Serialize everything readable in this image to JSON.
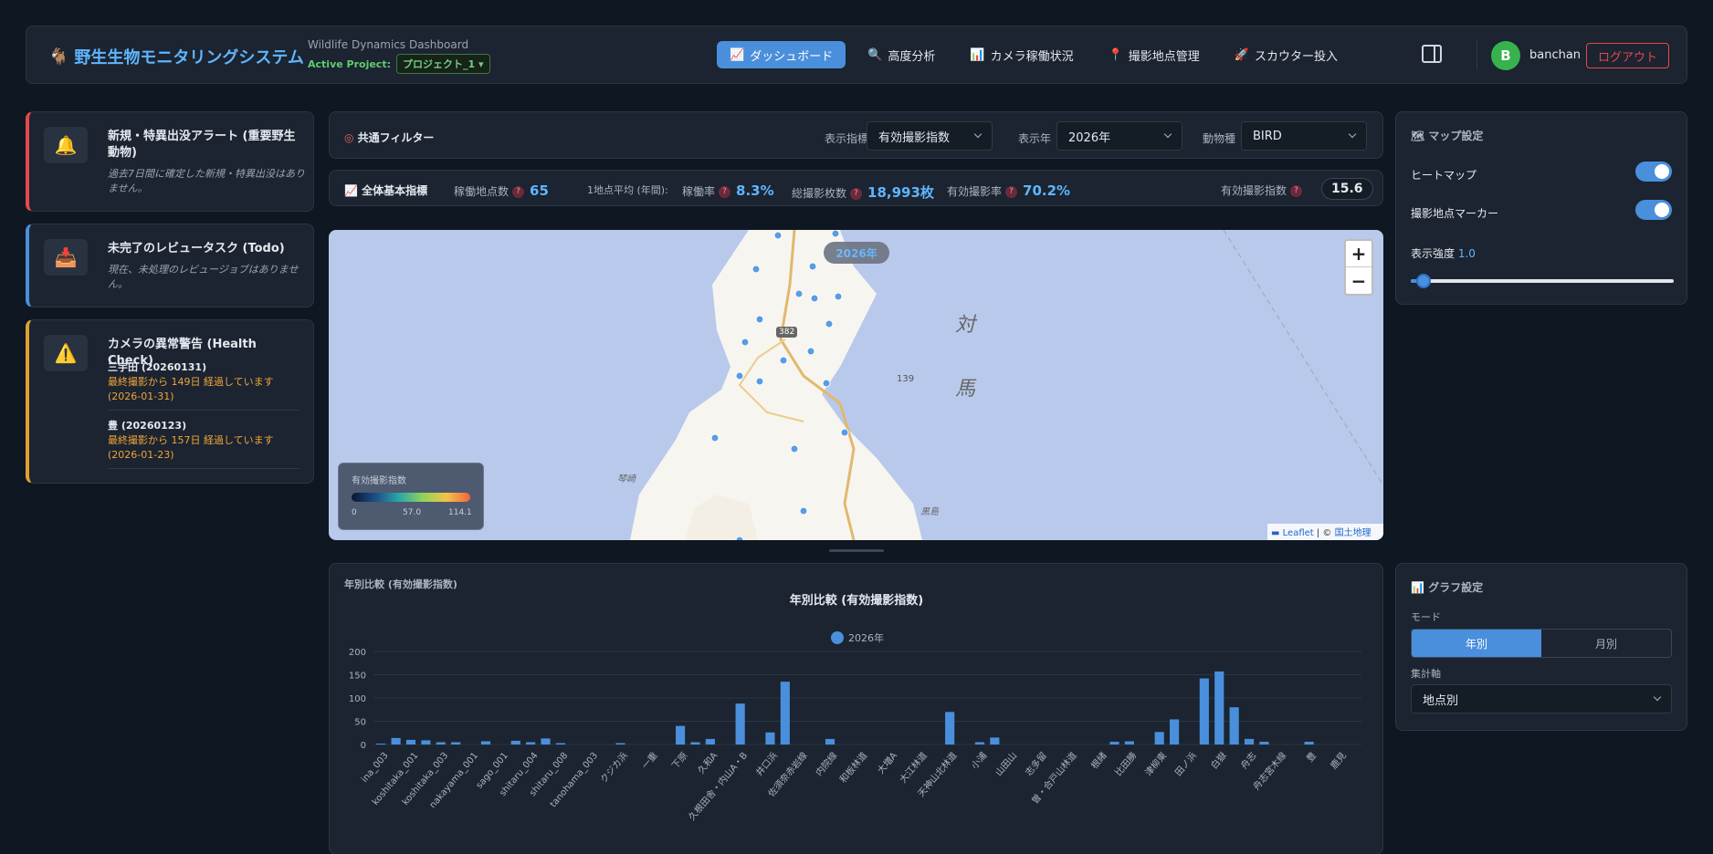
{
  "header": {
    "brand": "野生生物モニタリングシステム",
    "subtitle": "Wildlife Dynamics Dashboard",
    "project_label": "Active Project:",
    "project_value": "プロジェクト_1",
    "nav": [
      {
        "label": "ダッシュボード",
        "icon": "chart-icon",
        "active": true
      },
      {
        "label": "高度分析",
        "icon": "magnifier-icon",
        "active": false
      },
      {
        "label": "カメラ稼働状況",
        "icon": "bar-chart-icon",
        "active": false
      },
      {
        "label": "撮影地点管理",
        "icon": "pin-icon",
        "active": false
      },
      {
        "label": "スカウター投入",
        "icon": "rocket-icon",
        "active": false
      }
    ],
    "avatar_initial": "B",
    "user": "banchan",
    "logout": "ログアウト"
  },
  "alerts": {
    "new_title": "新規・特異出没アラート (重要野生動物)",
    "new_desc": "過去7日間に確定した新規・特異出没はありません。",
    "todo_title": "未完了のレビュータスク (Todo)",
    "todo_desc": "現在、未処理のレビュージョブはありません。",
    "health_title": "カメラの異常警告 (Health Check)",
    "health_items": [
      {
        "name": "三宇田 (20260131)",
        "warn": "最終撮影から 149日 経過しています (2026-01-31)"
      },
      {
        "name": "豊 (20260123)",
        "warn": "最終撮影から 157日 経過しています (2026-01-23)"
      }
    ]
  },
  "filter": {
    "title": "共通フィルター",
    "metric_label": "表示指標",
    "metric_value": "有効撮影指数",
    "year_label": "表示年",
    "year_value": "2026年",
    "species_label": "動物種",
    "species_value": "BIRD"
  },
  "metrics": {
    "title": "全体基本指標",
    "sites_label": "稼働地点数",
    "sites_value": "65",
    "avg_label": "1地点平均 (年間):",
    "rate_label": "稼働率",
    "rate_value": "8.3%",
    "photos_label": "総撮影枚数",
    "photos_value": "18,993枚",
    "valid_label": "有効撮影率",
    "valid_value": "70.2%",
    "index_label": "有効撮影指数",
    "index_value": "15.6"
  },
  "map": {
    "year_badge": "2026年",
    "zoom_in": "+",
    "zoom_out": "−",
    "legend_title": "有効撮影指数",
    "legend_min": "0",
    "legend_mid": "57.0",
    "legend_max": "114.1",
    "label_tsu": "対",
    "label_ma": "馬",
    "label_139": "139",
    "label_383": "382",
    "label_nishi": "琴崎",
    "label_kuro": "黒島",
    "attribution_leaflet": "Leaflet",
    "attribution_sep": " | © ",
    "attribution_gsi": "国土地理院"
  },
  "chart_panel": {
    "caption": "年別比較 (有効撮影指数)"
  },
  "chart_data": {
    "type": "bar",
    "title": "年別比較 (有効撮影指数)",
    "legend": "2026年",
    "ylim": [
      0,
      200
    ],
    "yticks": [
      0,
      50,
      100,
      150,
      200
    ],
    "categories": [
      "ina_003",
      "koshitaka_001",
      "koshitaka_003",
      "nakayama_001",
      "sago_001",
      "shitaru_004",
      "shitaru_008",
      "tanohama_003",
      "クジカ浜",
      "一重",
      "下原",
      "久和A",
      "久根田舎・内山A・B",
      "井口浜",
      "佐須奈赤岩線",
      "内院線",
      "和板林道",
      "大増A",
      "大江林道",
      "天神山北林道",
      "小浦",
      "山田山",
      "志多留",
      "曽・合戸山林道",
      "根緒",
      "比田勝",
      "津柳東",
      "田ノ浜",
      "白嶽",
      "舟志",
      "舟志宮木線",
      "豊",
      "鹿見"
    ],
    "values": [
      2,
      14,
      10,
      9,
      5,
      5,
      0,
      7,
      0,
      8,
      5,
      13,
      3,
      0,
      0,
      0,
      3,
      0,
      0,
      0,
      40,
      5,
      12,
      0,
      88,
      0,
      26,
      135,
      0,
      0,
      12,
      0,
      0,
      0,
      0,
      0,
      0,
      0,
      70,
      0,
      5,
      15,
      0,
      0,
      0,
      0,
      0,
      0,
      0,
      6,
      7,
      0,
      27,
      54,
      0,
      142,
      157,
      80,
      12,
      6,
      0,
      0,
      6,
      0,
      0,
      0
    ],
    "series": [
      {
        "name": "2026年",
        "color": "#4a8fdc"
      }
    ]
  },
  "map_settings": {
    "title": "マップ設定",
    "heatmap": "ヒートマップ",
    "markers": "撮影地点マーカー",
    "intensity_label": "表示強度",
    "intensity_value": "1.0"
  },
  "graph_settings": {
    "title": "グラフ設定",
    "mode_label": "モード",
    "mode_year": "年別",
    "mode_month": "月別",
    "axis_label": "集計軸",
    "axis_value": "地点別"
  }
}
